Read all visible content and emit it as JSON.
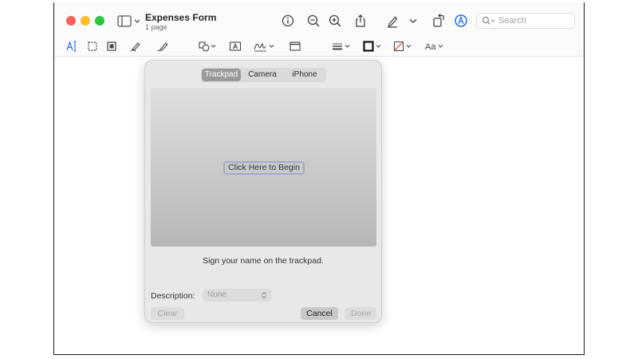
{
  "window": {
    "title": "Expenses Form",
    "subtitle": "1 page"
  },
  "toolbar": {
    "icons": [
      "sidebar-icon",
      "info-icon",
      "zoom-out-icon",
      "zoom-in-icon",
      "share-icon",
      "highlight-pen-icon",
      "chevron-down-icon",
      "rotate-icon",
      "markup-icon"
    ],
    "search_placeholder": "Search"
  },
  "markup_toolbar": {
    "icons": [
      "text-selection-icon",
      "rectangle-selection-icon",
      "smart-lasso-icon",
      "sketch-icon",
      "draw-icon",
      "shapes-icon",
      "text-box-icon",
      "signature-icon",
      "note-icon",
      "line-style-icon",
      "border-color-icon",
      "fill-color-icon",
      "text-style-icon"
    ],
    "text_style_label": "Aa"
  },
  "signature_popover": {
    "tabs": [
      {
        "label": "Trackpad",
        "active": true
      },
      {
        "label": "Camera",
        "active": false
      },
      {
        "label": "iPhone",
        "active": false
      }
    ],
    "begin_label": "Click Here to Begin",
    "hint": "Sign your name on the trackpad.",
    "description_label": "Description:",
    "description_value": "None",
    "clear_label": "Clear",
    "cancel_label": "Cancel",
    "done_label": "Done"
  },
  "colors": {
    "close": "#fe5f57",
    "minimize": "#febc2e",
    "maximize": "#28c840",
    "accent": "#2a6fdb"
  }
}
